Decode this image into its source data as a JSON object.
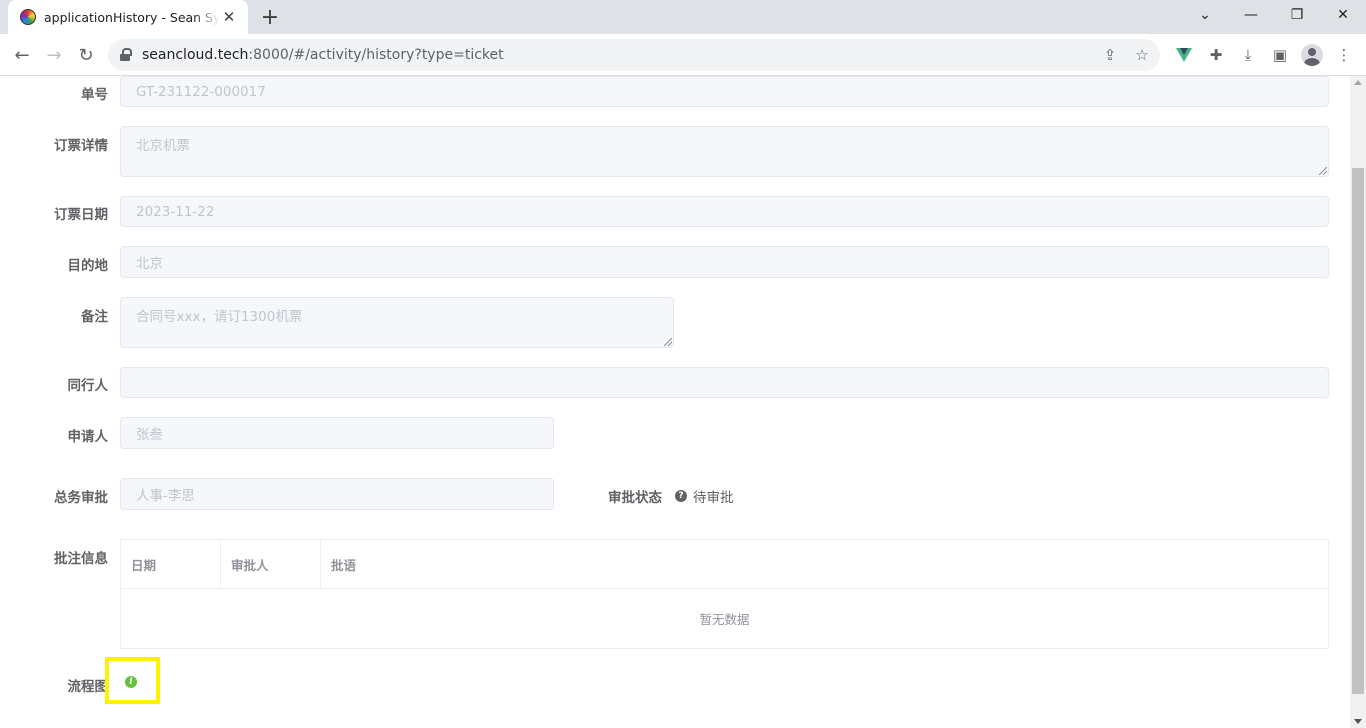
{
  "browser": {
    "tab_title": "applicationHistory - Sean System",
    "new_tab": "+",
    "close_tab": "✕",
    "url_host": "seancloud.tech",
    "url_path": ":8000/#/activity/history?type=ticket"
  },
  "form": {
    "order_no": {
      "label": "单号",
      "value": "GT-231122-000017"
    },
    "ticket_detail": {
      "label": "订票详情",
      "value": "北京机票"
    },
    "ticket_date": {
      "label": "订票日期",
      "value": "2023-11-22"
    },
    "destination": {
      "label": "目的地",
      "value": "北京"
    },
    "remark": {
      "label": "备注",
      "value": "合同号xxx，请订1300机票"
    },
    "companions": {
      "label": "同行人",
      "value": ""
    },
    "applicant": {
      "label": "申请人",
      "value": "张叁"
    },
    "general_approval": {
      "label": "总务审批",
      "value": "人事-李思"
    },
    "approval_status": {
      "label": "审批状态",
      "value": "待审批",
      "icon": "question-circle-icon"
    },
    "comments": {
      "label": "批注信息",
      "columns": [
        "日期",
        "审批人",
        "批语"
      ],
      "empty_text": "暂无数据"
    },
    "flowchart": {
      "label": "流程图",
      "icon": "info-circle-icon",
      "icon_color": "#67c23a"
    }
  }
}
